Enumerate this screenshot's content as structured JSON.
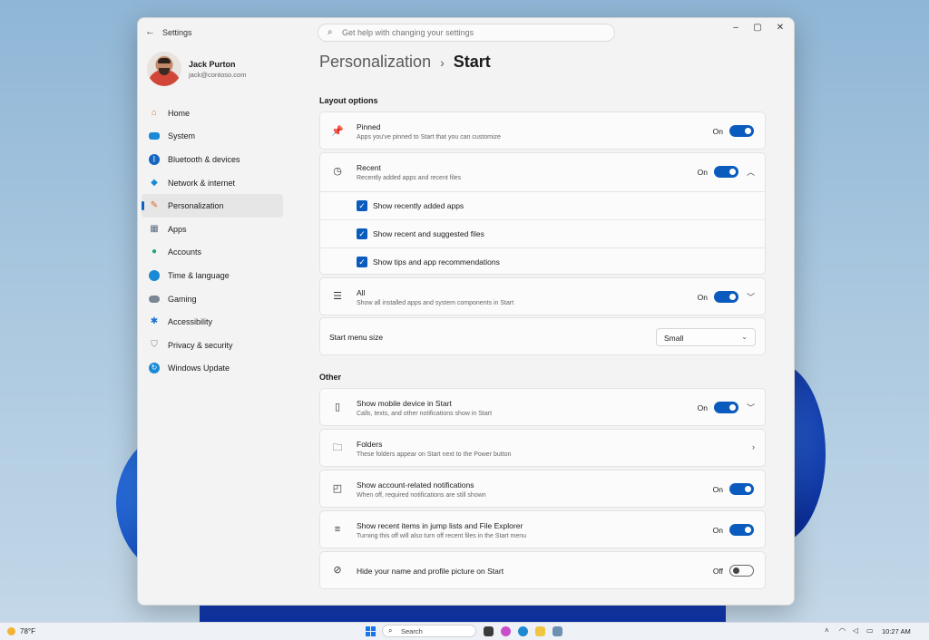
{
  "window": {
    "title": "Settings"
  },
  "search": {
    "placeholder": "Get help with changing your settings"
  },
  "user": {
    "name": "Jack Purton",
    "email": "jack@contoso.com"
  },
  "nav": [
    {
      "label": "Home",
      "icon": "home-icon",
      "color": "#e07a2f"
    },
    {
      "label": "System",
      "icon": "monitor-icon",
      "color": "#1a8ad4"
    },
    {
      "label": "Bluetooth & devices",
      "icon": "bluetooth-icon",
      "color": "#1565c0"
    },
    {
      "label": "Network & internet",
      "icon": "wifi-icon",
      "color": "#1a8ad4"
    },
    {
      "label": "Personalization",
      "icon": "brush-icon",
      "color": "#d86a2a",
      "active": true
    },
    {
      "label": "Apps",
      "icon": "apps-icon",
      "color": "#5a6b84"
    },
    {
      "label": "Accounts",
      "icon": "person-icon",
      "color": "#1fa37a"
    },
    {
      "label": "Time & language",
      "icon": "globe-clock-icon",
      "color": "#1a8ad4"
    },
    {
      "label": "Gaming",
      "icon": "gamepad-icon",
      "color": "#7b8593"
    },
    {
      "label": "Accessibility",
      "icon": "accessibility-icon",
      "color": "#1573d1"
    },
    {
      "label": "Privacy & security",
      "icon": "shield-icon",
      "color": "#7b8593"
    },
    {
      "label": "Windows Update",
      "icon": "update-icon",
      "color": "#1a8ad4"
    }
  ],
  "breadcrumb": {
    "parent": "Personalization",
    "separator": "›",
    "current": "Start"
  },
  "sections": {
    "layout": "Layout options",
    "other": "Other"
  },
  "pinned": {
    "title": "Pinned",
    "desc": "Apps you've pinned to Start that you can customize",
    "state": "On"
  },
  "recent": {
    "title": "Recent",
    "desc": "Recently added apps and recent files",
    "state": "On",
    "options": [
      "Show recently added apps",
      "Show recent and suggested files",
      "Show tips and app recommendations"
    ]
  },
  "all": {
    "title": "All",
    "desc": "Show all installed apps and system components in Start",
    "state": "On"
  },
  "menu_size": {
    "label": "Start menu size",
    "value": "Small"
  },
  "mobile": {
    "title": "Show mobile device in Start",
    "desc": "Calls, texts, and other notifications show in Start",
    "state": "On"
  },
  "folders": {
    "title": "Folders",
    "desc": "These folders appear on Start next to the Power button"
  },
  "account_notif": {
    "title": "Show account-related notifications",
    "desc": "When off, required notifications are still shown",
    "state": "On"
  },
  "jump_lists": {
    "title": "Show recent items in jump lists and File Explorer",
    "desc": "Turning this off will also turn off recent files in the Start menu",
    "state": "On"
  },
  "hide_name": {
    "title": "Hide your name and profile picture on Start",
    "state": "Off"
  },
  "taskbar": {
    "weather": "78°F",
    "search": "Search",
    "time": "10:27 AM"
  },
  "colors": {
    "accent": "#0a5bbd"
  }
}
